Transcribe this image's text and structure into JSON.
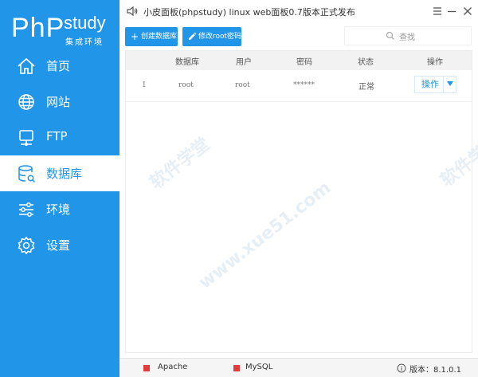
{
  "app": {
    "logo_main": "PhP",
    "logo_study": "study",
    "logo_sub": "集成环境",
    "title": "小皮面板(phpstudy) linux web面板0.7版本正式发布"
  },
  "sidebar": {
    "items": [
      {
        "label": "首页",
        "icon": "home-icon"
      },
      {
        "label": "网站",
        "icon": "globe-icon"
      },
      {
        "label": "FTP",
        "icon": "monitor-icon"
      },
      {
        "label": "数据库",
        "icon": "database-icon",
        "active": true
      },
      {
        "label": "环境",
        "icon": "sliders-icon"
      },
      {
        "label": "设置",
        "icon": "gear-icon"
      }
    ]
  },
  "toolbar": {
    "create_label": "创建数据库",
    "edit_label": "修改root密码",
    "search_placeholder": "查找"
  },
  "table": {
    "headers": [
      "数据库",
      "用户",
      "密码",
      "状态",
      "操作"
    ],
    "rows": [
      {
        "index": "1",
        "db": "root",
        "user": "root",
        "password": "******",
        "status": "正常",
        "op": "操作"
      }
    ]
  },
  "watermark": {
    "text1": "软件学堂",
    "text2": "www.xue51.com"
  },
  "statusbar": {
    "apache": "Apache",
    "mysql": "MySQL",
    "version": "版本：8.1.0.1"
  },
  "colors": {
    "accent": "#2196e8",
    "service_stopped": "#e33a3a"
  }
}
